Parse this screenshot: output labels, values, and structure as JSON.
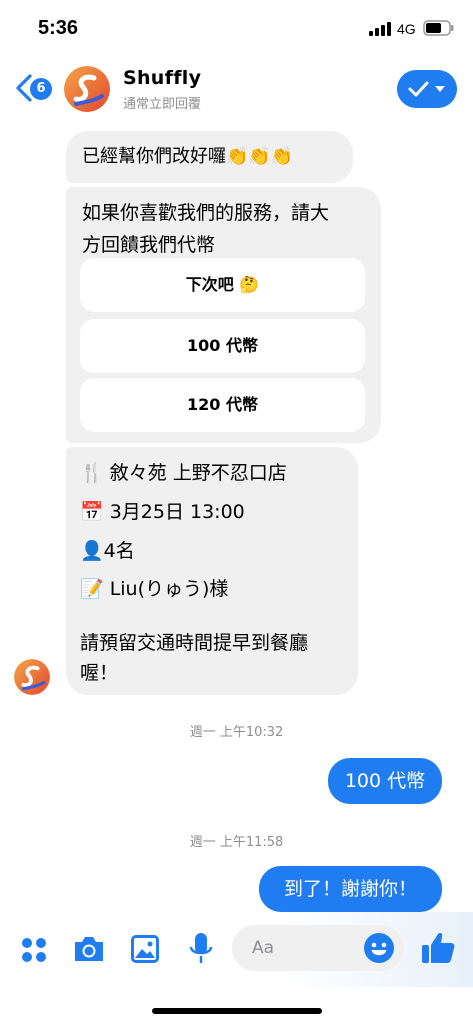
{
  "status_bar": {
    "time": "5:36",
    "network": "4G"
  },
  "header": {
    "back_badge": "6",
    "title": "Shuffly",
    "subtitle": "通常立即回覆"
  },
  "messages": {
    "m1": "已經幫你們改好囉👏👏👏",
    "m2_line1": "如果你喜歡我們的服務，請大",
    "m2_line2": "方回饋我們代幣",
    "quick_replies": [
      "下次吧 🤔",
      "100 代幣",
      "120 代幣"
    ],
    "booking": {
      "restaurant": "🍴 敘々苑 上野不忍口店",
      "datetime": "📅 3月25日 13:00",
      "people": "👤4名",
      "name": "📝 Liu(りゅう)様",
      "note_line1": "請預留交通時間提早到餐廳",
      "note_line2": "喔！"
    },
    "ts1": "週一 上午10:32",
    "out1": "100 代幣",
    "ts2": "週一 上午11:58",
    "out2": "到了！謝謝你！"
  },
  "composer": {
    "placeholder": "Aa"
  },
  "colors": {
    "accent": "#1f7cf1",
    "bubble_in": "#f0f0f0"
  }
}
